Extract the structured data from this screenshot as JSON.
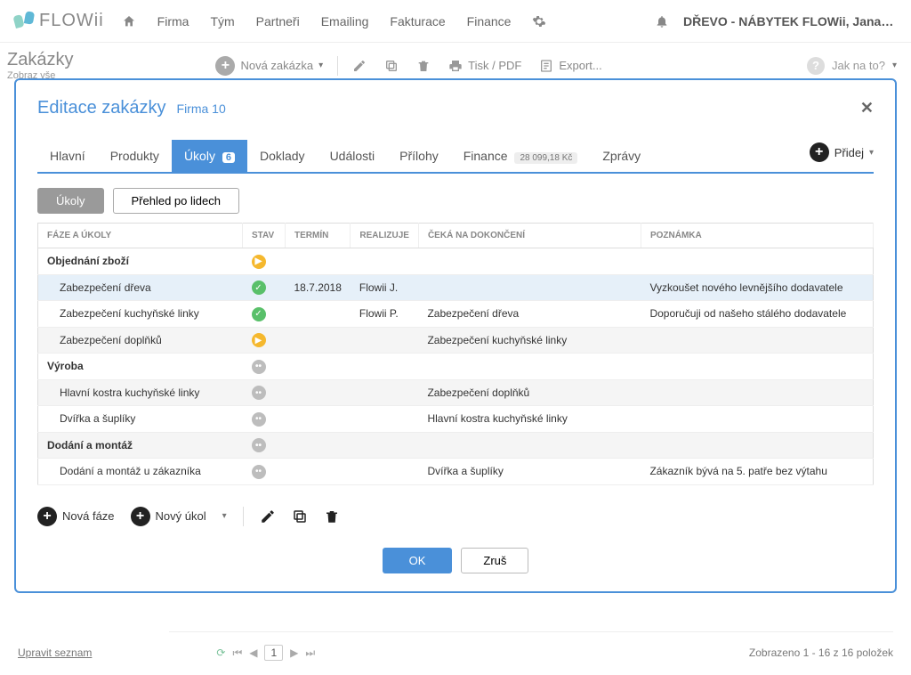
{
  "logo": "FLOWii",
  "nav": {
    "firma": "Firma",
    "tym": "Tým",
    "partneri": "Partneři",
    "emailing": "Emailing",
    "fakturace": "Fakturace",
    "finance": "Finance"
  },
  "org_name": "DŘEVO - NÁBYTEK FLOWii, Jana Fl…",
  "page": {
    "title": "Zakázky",
    "subtitle": "Zobraz vše"
  },
  "subactions": {
    "nova_zakazka": "Nová zakázka",
    "tisk": "Tisk / PDF",
    "export": "Export...",
    "jak_na_to": "Jak na to?"
  },
  "modal": {
    "title": "Editace zakázky",
    "firm_link": "Firma 10",
    "tabs": {
      "hlavni": "Hlavní",
      "produkty": "Produkty",
      "ukoly": "Úkoly",
      "ukoly_badge": "6",
      "doklady": "Doklady",
      "udalosti": "Události",
      "prilohy": "Přílohy",
      "finance": "Finance",
      "finance_badge": "28 099,18 Kč",
      "zpravy": "Zprávy",
      "pridej": "Přidej"
    },
    "view_toggle": {
      "ukoly": "Úkoly",
      "prehled": "Přehled po lidech"
    },
    "headers": {
      "faze": "FÁZE A ÚKOLY",
      "stav": "STAV",
      "termin": "TERMÍN",
      "realizuje": "REALIZUJE",
      "ceka": "ČEKÁ NA DOKONČENÍ",
      "poznamka": "POZNÁMKA"
    },
    "rows": {
      "p1": "Objednání zboží",
      "r1": {
        "name": "Zabezpečení dřeva",
        "termin": "18.7.2018",
        "realizuje": "Flowii J.",
        "poznamka": "Vyzkoušet nového levnějšího dodavatele"
      },
      "r2": {
        "name": "Zabezpečení kuchyňské linky",
        "realizuje": "Flowii P.",
        "ceka": "Zabezpečení dřeva",
        "poznamka": "Doporučuji od našeho stálého dodavatele"
      },
      "r3": {
        "name": "Zabezpečení doplňků",
        "ceka": "Zabezpečení kuchyňské linky"
      },
      "p2": "Výroba",
      "r4": {
        "name": "Hlavní kostra kuchyňské linky",
        "ceka": "Zabezpečení doplňků"
      },
      "r5": {
        "name": "Dvířka a šuplíky",
        "ceka": "Hlavní kostra kuchyňské linky"
      },
      "p3": "Dodání a montáž",
      "r6": {
        "name": "Dodání a montáž u zákazníka",
        "ceka": "Dvířka a šuplíky",
        "poznamka": "Zákazník bývá na 5. patře bez výtahu"
      }
    },
    "bottom": {
      "nova_faze": "Nová fáze",
      "novy_ukol": "Nový úkol"
    },
    "footer": {
      "ok": "OK",
      "zrus": "Zruš"
    }
  },
  "footer": {
    "edit_list": "Upravit seznam",
    "page": "1",
    "result": "Zobrazeno 1 - 16 z 16 položek"
  }
}
